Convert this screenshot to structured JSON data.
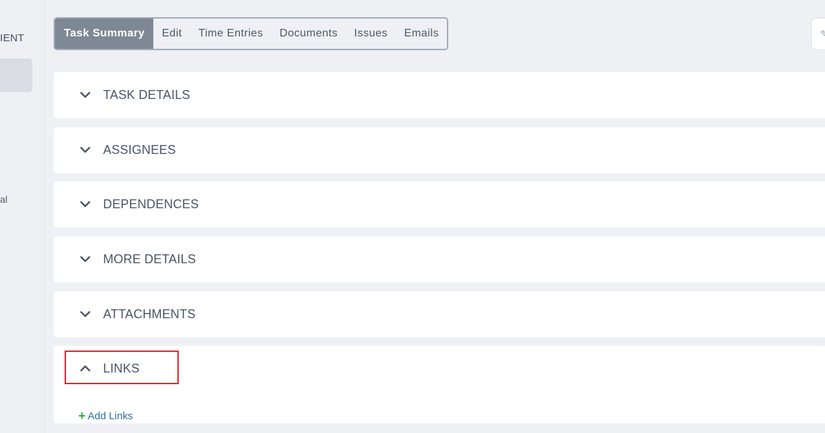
{
  "sidebar": {
    "title_partial": "IENT",
    "item_partial": "al"
  },
  "tabs": [
    {
      "label": "Task Summary",
      "active": true
    },
    {
      "label": "Edit",
      "active": false
    },
    {
      "label": "Time Entries",
      "active": false
    },
    {
      "label": "Documents",
      "active": false
    },
    {
      "label": "Issues",
      "active": false
    },
    {
      "label": "Emails",
      "active": false
    }
  ],
  "sections": {
    "task_details": "TASK DETAILS",
    "assignees": "ASSIGNEES",
    "dependences": "DEPENDENCES",
    "more_details": "MORE DETAILS",
    "attachments": "ATTACHMENTS",
    "links": "LINKS"
  },
  "links": {
    "add_label": "Add Links",
    "add_icon": "plus-icon"
  },
  "colors": {
    "active_tab_bg": "#7e8894",
    "highlight": "#e0262d",
    "add_link": "#2f6f9f",
    "plus": "#2fa84f"
  },
  "icons": {
    "collapsed": "chevron-down-icon",
    "expanded": "chevron-up-icon",
    "corner": "edit-icon"
  }
}
